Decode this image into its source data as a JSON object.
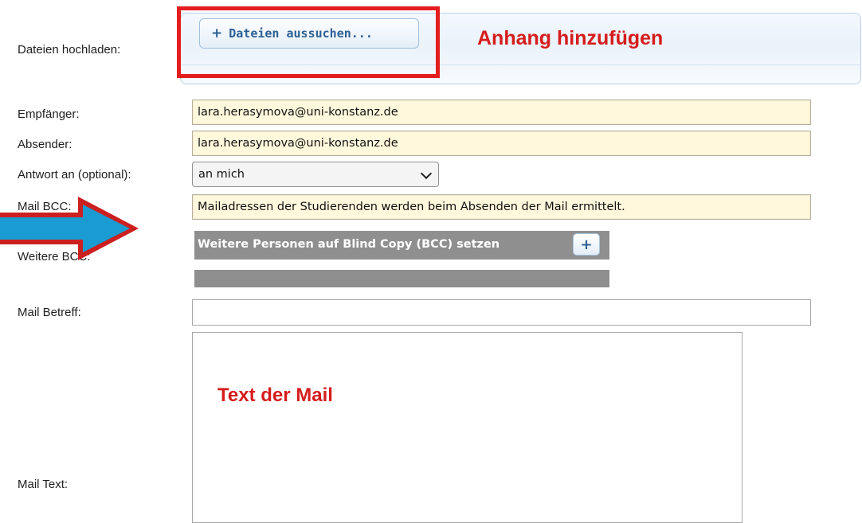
{
  "labels": {
    "upload": "Dateien hochladen:",
    "recipient": "Empfänger:",
    "sender": "Absender:",
    "reply_to": "Antwort an (optional):",
    "bcc": "Mail BCC:",
    "more_bcc": "Weitere BCC:",
    "subject": "Mail Betreff:",
    "body": "Mail Text:"
  },
  "upload": {
    "button_icon": "plus-icon",
    "button_label": "Dateien aussuchen..."
  },
  "annotations": {
    "attachment": "Anhang hinzufügen",
    "mail_text": "Text der Mail",
    "highlight_color": "#e41e1e",
    "arrow_icon": "right-arrow-icon",
    "arrow_color": "#1a9bd1"
  },
  "fields": {
    "recipient_value": "lara.herasymova@uni-konstanz.de",
    "sender_value": "lara.herasymova@uni-konstanz.de",
    "reply_to_selected": "an mich",
    "bcc_value": "Mailadressen der Studierenden werden beim Absenden der Mail ermittelt.",
    "subject_value": "",
    "body_value": ""
  },
  "more_bcc": {
    "button_label": "Weitere Personen auf Blind Copy (BCC) setzen",
    "add_icon": "plus-icon"
  },
  "colors": {
    "readonly_field_bg": "#fff8dc",
    "bcc_bar_bg": "#8f8f8f",
    "link_blue": "#2d5f93"
  }
}
